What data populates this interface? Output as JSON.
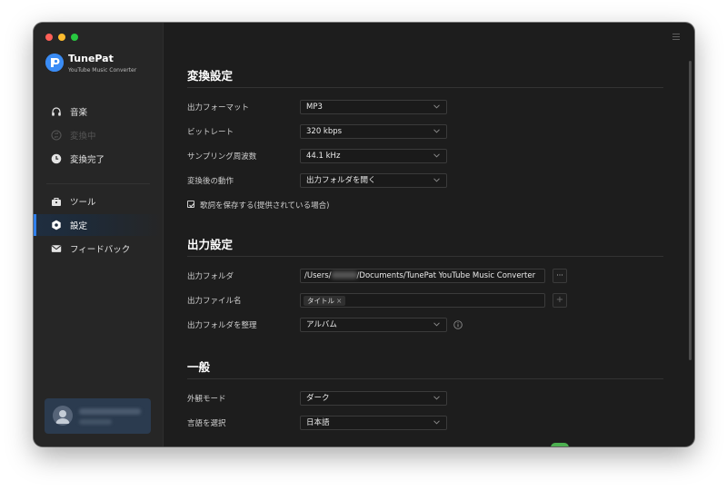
{
  "app": {
    "name": "TunePat",
    "subtitle": "YouTube Music Converter"
  },
  "sidebar": {
    "items": [
      {
        "label": "音楽",
        "icon": "headphones-icon",
        "disabled": false,
        "active": false
      },
      {
        "label": "変換中",
        "icon": "converting-icon",
        "disabled": true,
        "active": false
      },
      {
        "label": "変換完了",
        "icon": "clock-icon",
        "disabled": false,
        "active": false
      },
      {
        "label": "ツール",
        "icon": "toolbox-icon",
        "disabled": false,
        "active": false
      },
      {
        "label": "設定",
        "icon": "settings-icon",
        "disabled": false,
        "active": true
      },
      {
        "label": "フィードバック",
        "icon": "mail-icon",
        "disabled": false,
        "active": false
      }
    ]
  },
  "convert_settings": {
    "title": "変換設定",
    "output_format": {
      "label": "出力フォーマット",
      "value": "MP3"
    },
    "bitrate": {
      "label": "ビットレート",
      "value": "320 kbps"
    },
    "sample_rate": {
      "label": "サンプリング周波数",
      "value": "44.1 kHz"
    },
    "after_convert": {
      "label": "変換後の動作",
      "value": "出力フォルダを開く"
    },
    "save_lyrics": {
      "label": "歌詞を保存する(提供されている場合)",
      "checked": true
    }
  },
  "output_settings": {
    "title": "出力設定",
    "output_folder": {
      "label": "出力フォルダ",
      "value_prefix": "/Users/",
      "value_suffix": "/Documents/TunePat YouTube Music Converter",
      "browse_label": "···"
    },
    "file_name": {
      "label": "出力ファイル名",
      "tag": "タイトル",
      "add_label": "+"
    },
    "organize": {
      "label": "出力フォルダを整理",
      "value": "アルバム"
    }
  },
  "general": {
    "title": "一般",
    "appearance": {
      "label": "外観モード",
      "value": "ダーク"
    },
    "language": {
      "label": "言語を選択",
      "value": "日本語"
    }
  },
  "colors": {
    "accent": "#2f80ed",
    "toggle_on": "#4cb050",
    "background": "#1d1d1d",
    "sidebar": "#262626"
  }
}
